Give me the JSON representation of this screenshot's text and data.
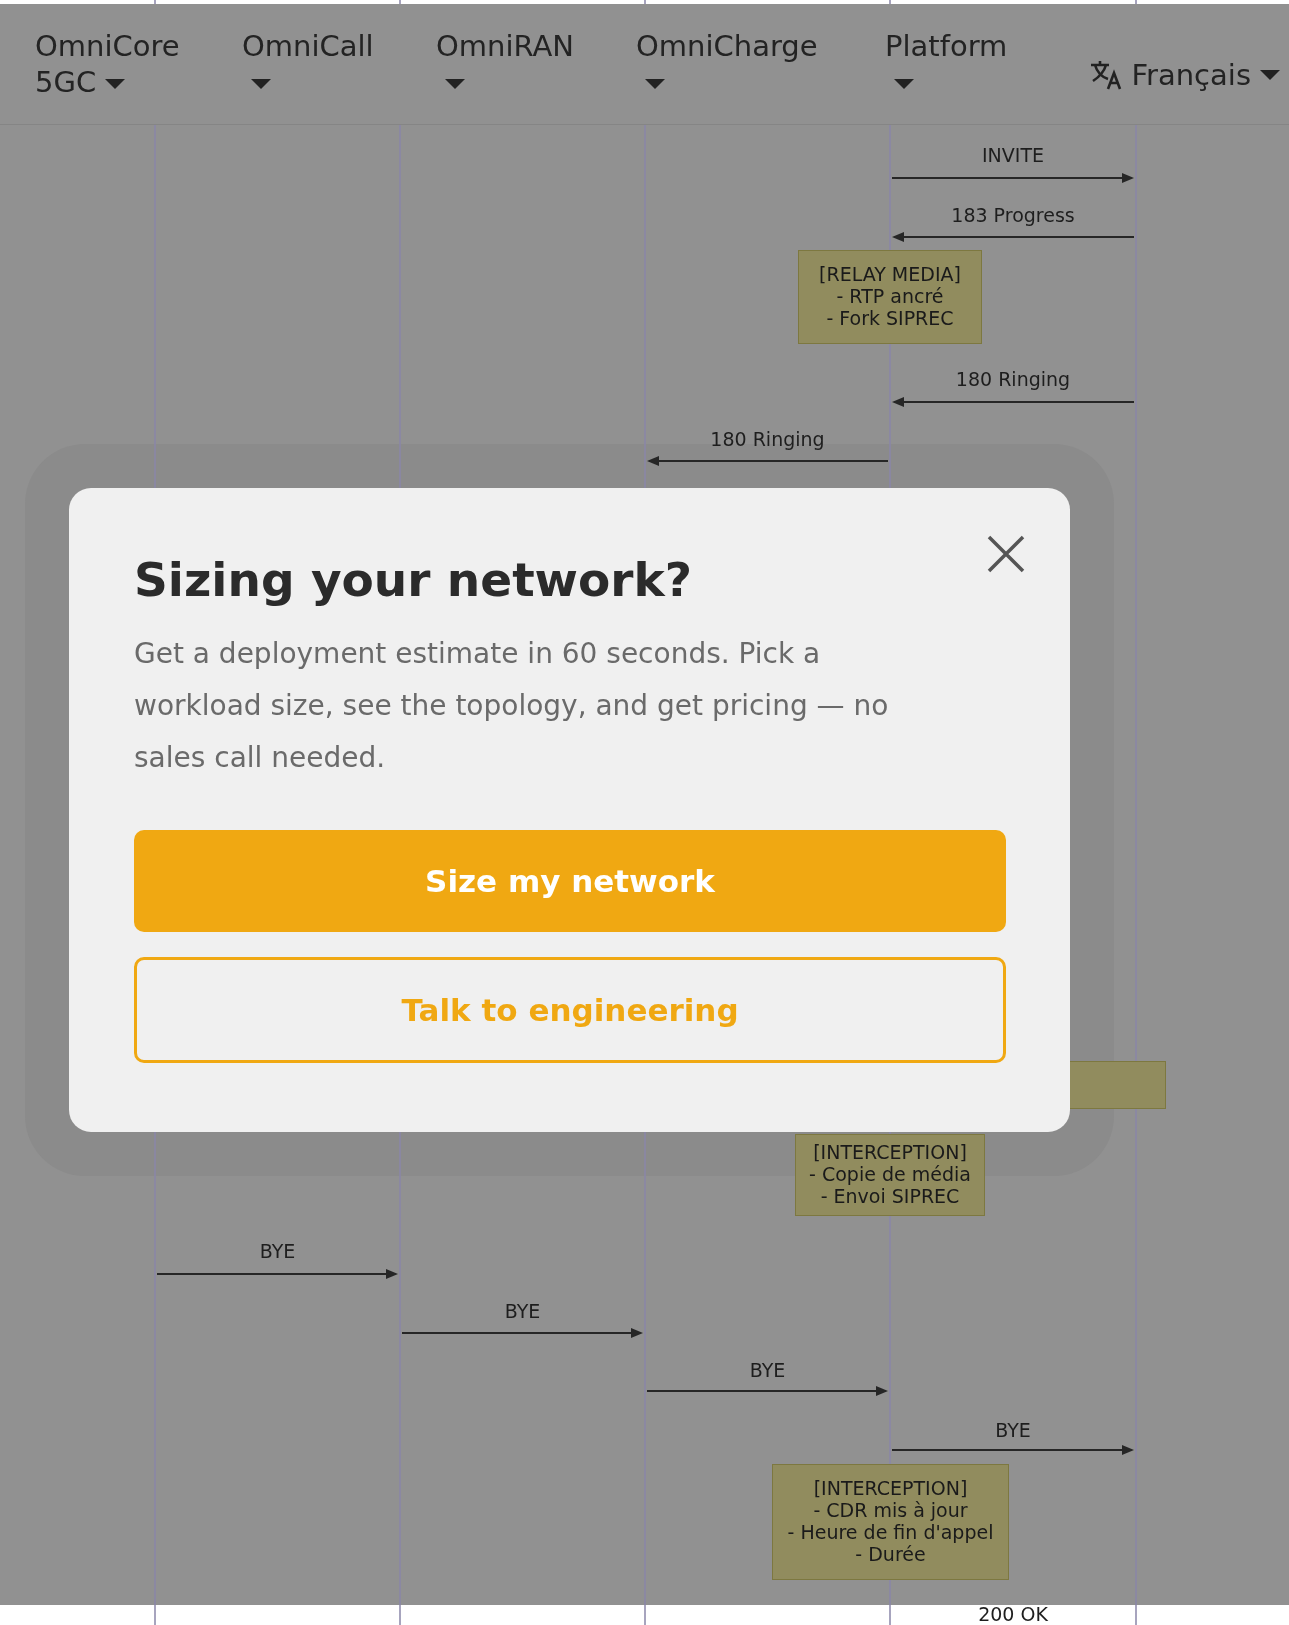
{
  "nav": {
    "items": [
      {
        "label": "OmniCore 5GC"
      },
      {
        "label": "OmniCall"
      },
      {
        "label": "OmniRAN"
      },
      {
        "label": "OmniCharge"
      },
      {
        "label": "Platform"
      }
    ],
    "language": "Français"
  },
  "diagram": {
    "messages": [
      {
        "label": "INVITE",
        "rightward": true
      },
      {
        "label": "183 Progress",
        "rightward": false
      },
      {
        "label": "180 Ringing",
        "rightward": false
      },
      {
        "label": "180 Ringing",
        "rightward": false
      },
      {
        "label": "BYE",
        "rightward": true
      },
      {
        "label": "BYE",
        "rightward": true
      },
      {
        "label": "BYE",
        "rightward": true
      },
      {
        "label": "BYE",
        "rightward": true
      },
      {
        "label": "200 OK"
      }
    ],
    "notes": [
      {
        "lines": [
          "[RELAY MEDIA]",
          "- RTP ancré",
          "- Fork SIPREC"
        ]
      },
      {
        "lines": [
          "[INTERCEPTION]",
          "- Copie de média",
          "- Envoi SIPREC"
        ]
      },
      {
        "lines": [
          "[INTERCEPTION]",
          "- CDR mis à jour",
          "- Heure de fin d'appel",
          "- Durée"
        ]
      }
    ]
  },
  "modal": {
    "title": "Sizing your network?",
    "text": "Get a deployment estimate in 60 seconds. Pick a workload size, see the topology, and get pricing — no sales call needed.",
    "primary_button": "Size my network",
    "secondary_button": "Talk to engineering"
  }
}
